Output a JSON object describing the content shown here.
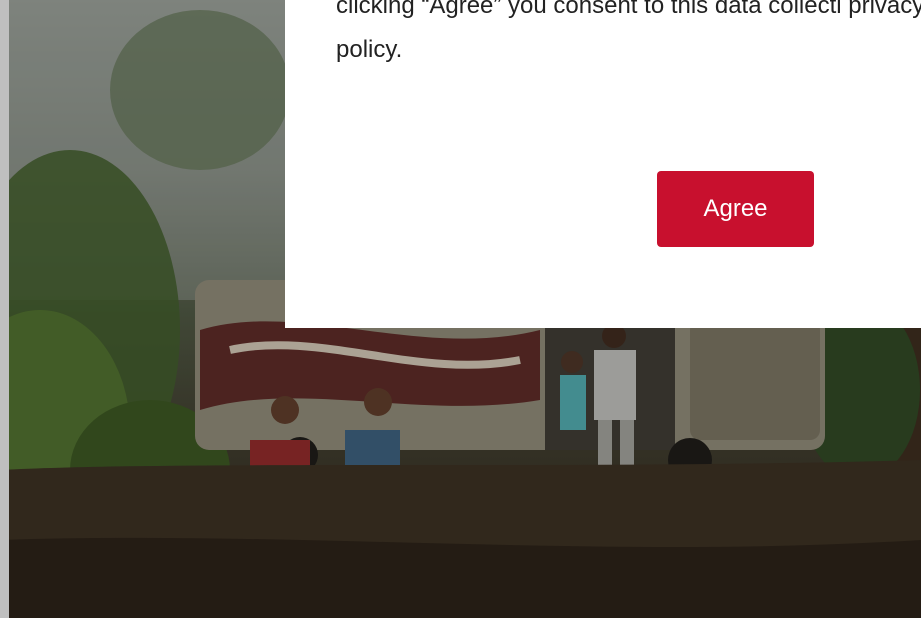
{
  "consent": {
    "text": "clicking “Agree” you consent to this data collecti privacy policy.",
    "agree_label": "Agree"
  },
  "colors": {
    "agree_button": "#c8102e",
    "panel": "#ffffff",
    "text": "#222222"
  }
}
